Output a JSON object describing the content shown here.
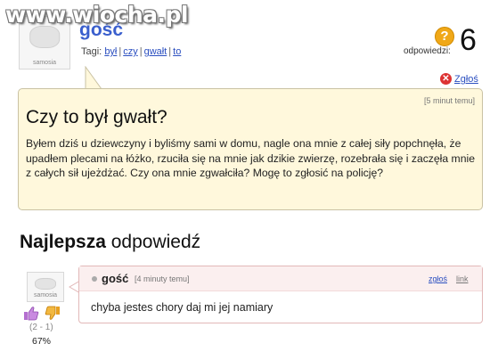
{
  "watermark": "www.wiocha.pl",
  "avatar": {
    "brand": "samosia"
  },
  "question": {
    "author": "gość",
    "tags_label": "Tagi:",
    "tags": [
      "był",
      "czy",
      "gwałt",
      "to"
    ],
    "answers_icon": "question-mark-icon",
    "answers_label": "odpowiedzi:",
    "answers_count": "6",
    "report_label": "Zgłoś",
    "time": "[5 minut temu]",
    "title": "Czy to był gwałt?",
    "body": "Byłem dziś u dziewczyny i byliśmy sami w domu, nagle ona mnie z całej siły popchnęła, że upadłem plecami na łóżko, rzuciła się na mnie jak dzikie zwierzę, rozebrała się i zaczęła mnie z całych sił ujeżdżać. Czy ona mnie zgwałciła? Mogę to zgłosić na policję?"
  },
  "best_answer": {
    "heading_bold": "Najlepsza",
    "heading_rest": "odpowiedź",
    "author": "gość",
    "time": "[4 minuty temu]",
    "report_label": "zgłoś",
    "link_label": "link",
    "text": "chyba jestes chory daj mi jej namiary",
    "votes": "(2 - 1)",
    "percent": "67%",
    "colors": {
      "thumb_up": "#b46fd0",
      "thumb_down": "#e8a020",
      "border": "#e2b8b8"
    }
  }
}
